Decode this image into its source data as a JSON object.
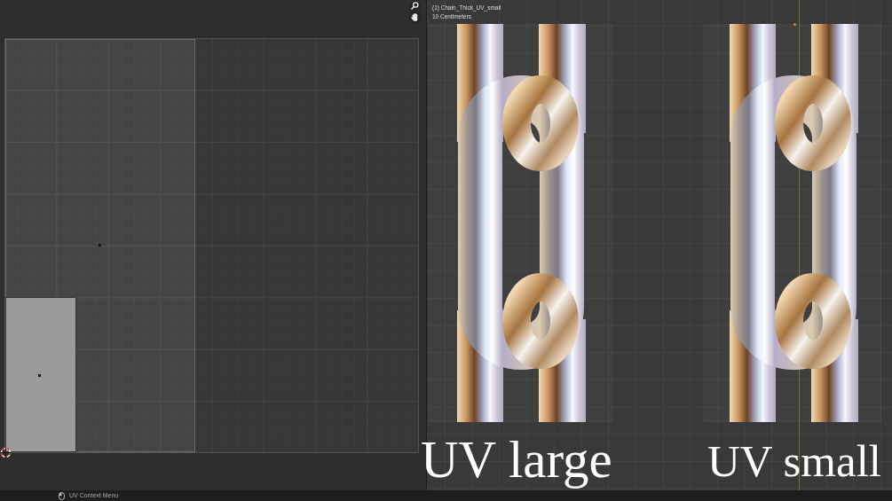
{
  "viewport": {
    "overlay_lines": [
      "(1) Chain_Thick_UV_small",
      "10 Centimeters"
    ],
    "objects": [
      {
        "caption": "UV large"
      },
      {
        "caption": "UV small"
      }
    ]
  },
  "status_bar": {
    "hint": "UV Context Menu"
  }
}
